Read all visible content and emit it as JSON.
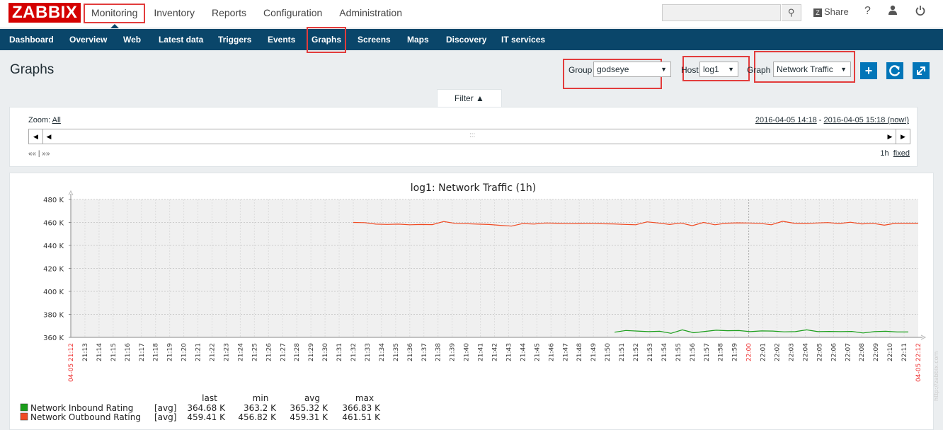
{
  "topbar": {
    "logo": "ZABBIX",
    "nav": [
      "Monitoring",
      "Inventory",
      "Reports",
      "Configuration",
      "Administration"
    ],
    "active_nav": "Monitoring",
    "share_label": "Share",
    "help_icon": "question-icon",
    "user_icon": "user-icon",
    "logout_icon": "power-icon",
    "search_icon": "search-icon"
  },
  "subnav": {
    "items": [
      "Dashboard",
      "Overview",
      "Web",
      "Latest data",
      "Triggers",
      "Events",
      "Graphs",
      "Screens",
      "Maps",
      "Discovery",
      "IT services"
    ],
    "active": "Graphs"
  },
  "page": {
    "title": "Graphs",
    "group_label": "Group",
    "group_value": "godseye",
    "host_label": "Host",
    "host_value": "log1",
    "graph_label": "Graph",
    "graph_value": "Network Traffic"
  },
  "filter": {
    "tab_label": "Filter ▲",
    "zoom_label": "Zoom:",
    "zoom_value": "All",
    "period_from": "2016-04-05 14:18",
    "period_sep": " - ",
    "period_to": "2016-04-05 15:18 (now!)",
    "nav_short": "«« | »»",
    "span": "1h",
    "fixed_label": "fixed"
  },
  "chart_data": {
    "type": "line",
    "title": "log1: Network Traffic (1h)",
    "y_ticks": [
      "480 K",
      "460 K",
      "440 K",
      "420 K",
      "400 K",
      "380 K",
      "360 K"
    ],
    "ylim": [
      360,
      480
    ],
    "x_start_label": "04-05 21:12",
    "x_end_label": "04-05 22:12",
    "x_ticks": [
      "21:13",
      "21:14",
      "21:15",
      "21:16",
      "21:17",
      "21:18",
      "21:19",
      "21:20",
      "21:21",
      "21:22",
      "21:23",
      "21:24",
      "21:25",
      "21:26",
      "21:27",
      "21:28",
      "21:29",
      "21:30",
      "21:31",
      "21:32",
      "21:33",
      "21:34",
      "21:35",
      "21:36",
      "21:37",
      "21:38",
      "21:39",
      "21:40",
      "21:41",
      "21:42",
      "21:43",
      "21:44",
      "21:45",
      "21:46",
      "21:47",
      "21:48",
      "21:49",
      "21:50",
      "21:51",
      "21:52",
      "21:53",
      "21:54",
      "21:55",
      "21:56",
      "21:57",
      "21:58",
      "21:59",
      "22:00",
      "22:01",
      "22:02",
      "22:03",
      "22:04",
      "22:05",
      "22:06",
      "22:07",
      "22:08",
      "22:09",
      "22:10",
      "22:11"
    ],
    "highlight_ticks": [
      "22:00"
    ],
    "series": [
      {
        "name": "Network Inbound Rating",
        "color": "#1a9e1a",
        "x_start": 38.5,
        "values": [
          364.5,
          366.0,
          365.5,
          365.0,
          365.3,
          363.5,
          366.5,
          364.0,
          365.2,
          366.2,
          365.8,
          365.9,
          365.0,
          365.6,
          365.5,
          364.8,
          365.0,
          366.5,
          365.0,
          365.2,
          365.0,
          365.2,
          363.8,
          365.0,
          365.3,
          364.7,
          364.7
        ]
      },
      {
        "name": "Network Outbound Rating",
        "color": "#f04a22",
        "x_start": 20,
        "values": [
          460.0,
          459.8,
          458.5,
          458.3,
          458.5,
          458.0,
          458.2,
          458.1,
          460.8,
          459.2,
          458.9,
          458.5,
          458.2,
          457.5,
          456.8,
          459.0,
          458.6,
          459.5,
          459.3,
          458.9,
          459.0,
          459.2,
          458.8,
          458.7,
          458.3,
          458.0,
          460.5,
          459.5,
          458.2,
          459.5,
          457.2,
          460.0,
          458.0,
          459.3,
          459.6,
          459.5,
          459.2,
          458.0,
          461.0,
          459.3,
          459.0,
          459.5,
          459.9,
          459.0,
          460.2,
          458.7,
          459.2,
          457.6,
          459.3,
          459.3,
          459.3
        ]
      }
    ],
    "legend": {
      "headers": [
        "last",
        "min",
        "avg",
        "max"
      ],
      "rows": [
        {
          "name": "Network Inbound Rating",
          "func": "[avg]",
          "last": "364.68 K",
          "min": "363.2 K",
          "avg": "365.32 K",
          "max": "366.83 K",
          "color": "#1a9e1a"
        },
        {
          "name": "Network Outbound Rating",
          "func": "[avg]",
          "last": "459.41 K",
          "min": "456.82 K",
          "avg": "459.31 K",
          "max": "461.51 K",
          "color": "#f04a22"
        }
      ]
    },
    "watermark": "http://zabbix.com"
  }
}
